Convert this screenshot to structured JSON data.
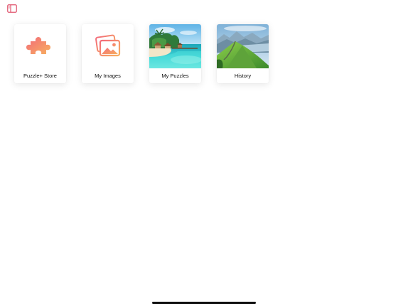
{
  "toolbar": {
    "sidebar_icon": "sidebar-toggle-icon",
    "accent_color": "#e0556e"
  },
  "tiles": [
    {
      "label": "Puzzle+ Store",
      "icon": "puzzle-piece-icon"
    },
    {
      "label": "My Images",
      "icon": "images-icon"
    },
    {
      "label": "My Puzzles",
      "icon": "tropical-beach-thumbnail"
    },
    {
      "label": "History",
      "icon": "mountain-landscape-thumbnail"
    }
  ],
  "colors": {
    "gradient_start": "#f36a7a",
    "gradient_end": "#f7b05f"
  }
}
